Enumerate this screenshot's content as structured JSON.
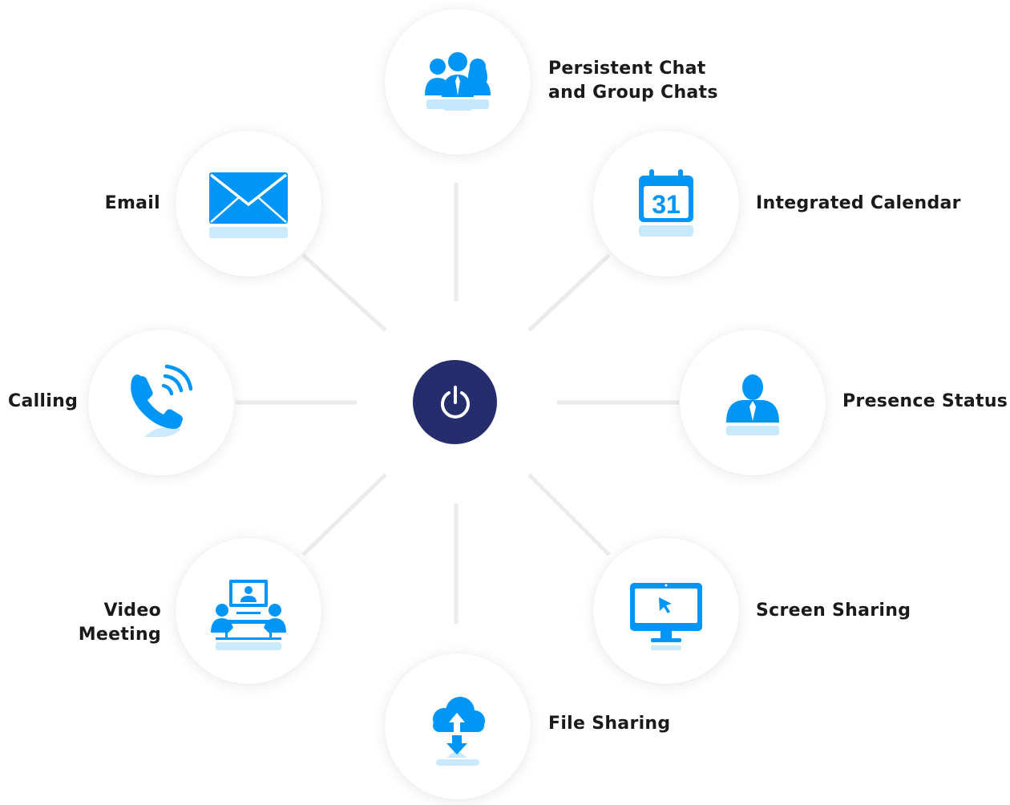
{
  "colors": {
    "icon_blue": "#0096f7",
    "center_navy": "#252d6d",
    "connector_gray": "#ebebeb",
    "label_text": "#1a1a1a"
  },
  "center": {
    "icon": "power-icon"
  },
  "features": [
    {
      "id": "persistent-chat",
      "label": "Persistent Chat\nand Group Chats",
      "icon": "group-people-icon"
    },
    {
      "id": "integrated-calendar",
      "label": "Integrated Calendar",
      "icon": "calendar-icon",
      "icon_text": "31"
    },
    {
      "id": "presence-status",
      "label": "Presence Status",
      "icon": "person-icon"
    },
    {
      "id": "screen-sharing",
      "label": "Screen Sharing",
      "icon": "monitor-cursor-icon"
    },
    {
      "id": "file-sharing",
      "label": "File Sharing",
      "icon": "cloud-upload-download-icon"
    },
    {
      "id": "video-meeting",
      "label": "Video Meeting",
      "icon": "video-conference-icon"
    },
    {
      "id": "calling",
      "label": "Calling",
      "icon": "phone-ringing-icon"
    },
    {
      "id": "email",
      "label": "Email",
      "icon": "envelope-icon"
    }
  ]
}
